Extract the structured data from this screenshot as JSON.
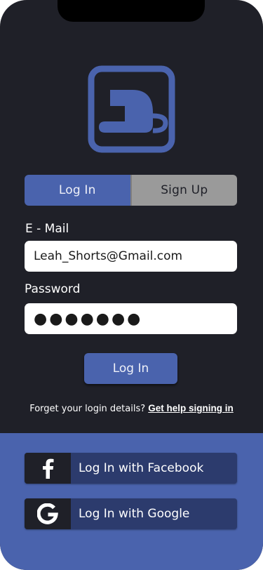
{
  "colors": {
    "background": "#1f2028",
    "accent": "#4a63ad",
    "inactive_tab": "#9a9a9a",
    "social_button": "#2c3b6d"
  },
  "logo": {
    "icon": "app-logo-cup-icon"
  },
  "tabs": {
    "login_label": "Log In",
    "signup_label": "Sign Up",
    "active": "Log In"
  },
  "form": {
    "email_label": "E - Mail",
    "email_value": "Leah_Shorts@Gmail.com",
    "password_label": "Password",
    "password_value": "●●●●●●●",
    "submit_label": "Log In"
  },
  "help": {
    "prompt": "Forget your login details?",
    "link": "Get help signing in"
  },
  "social": [
    {
      "icon": "facebook-icon",
      "label": "Log In with Facebook"
    },
    {
      "icon": "google-icon",
      "label": "Log In with Google"
    }
  ]
}
